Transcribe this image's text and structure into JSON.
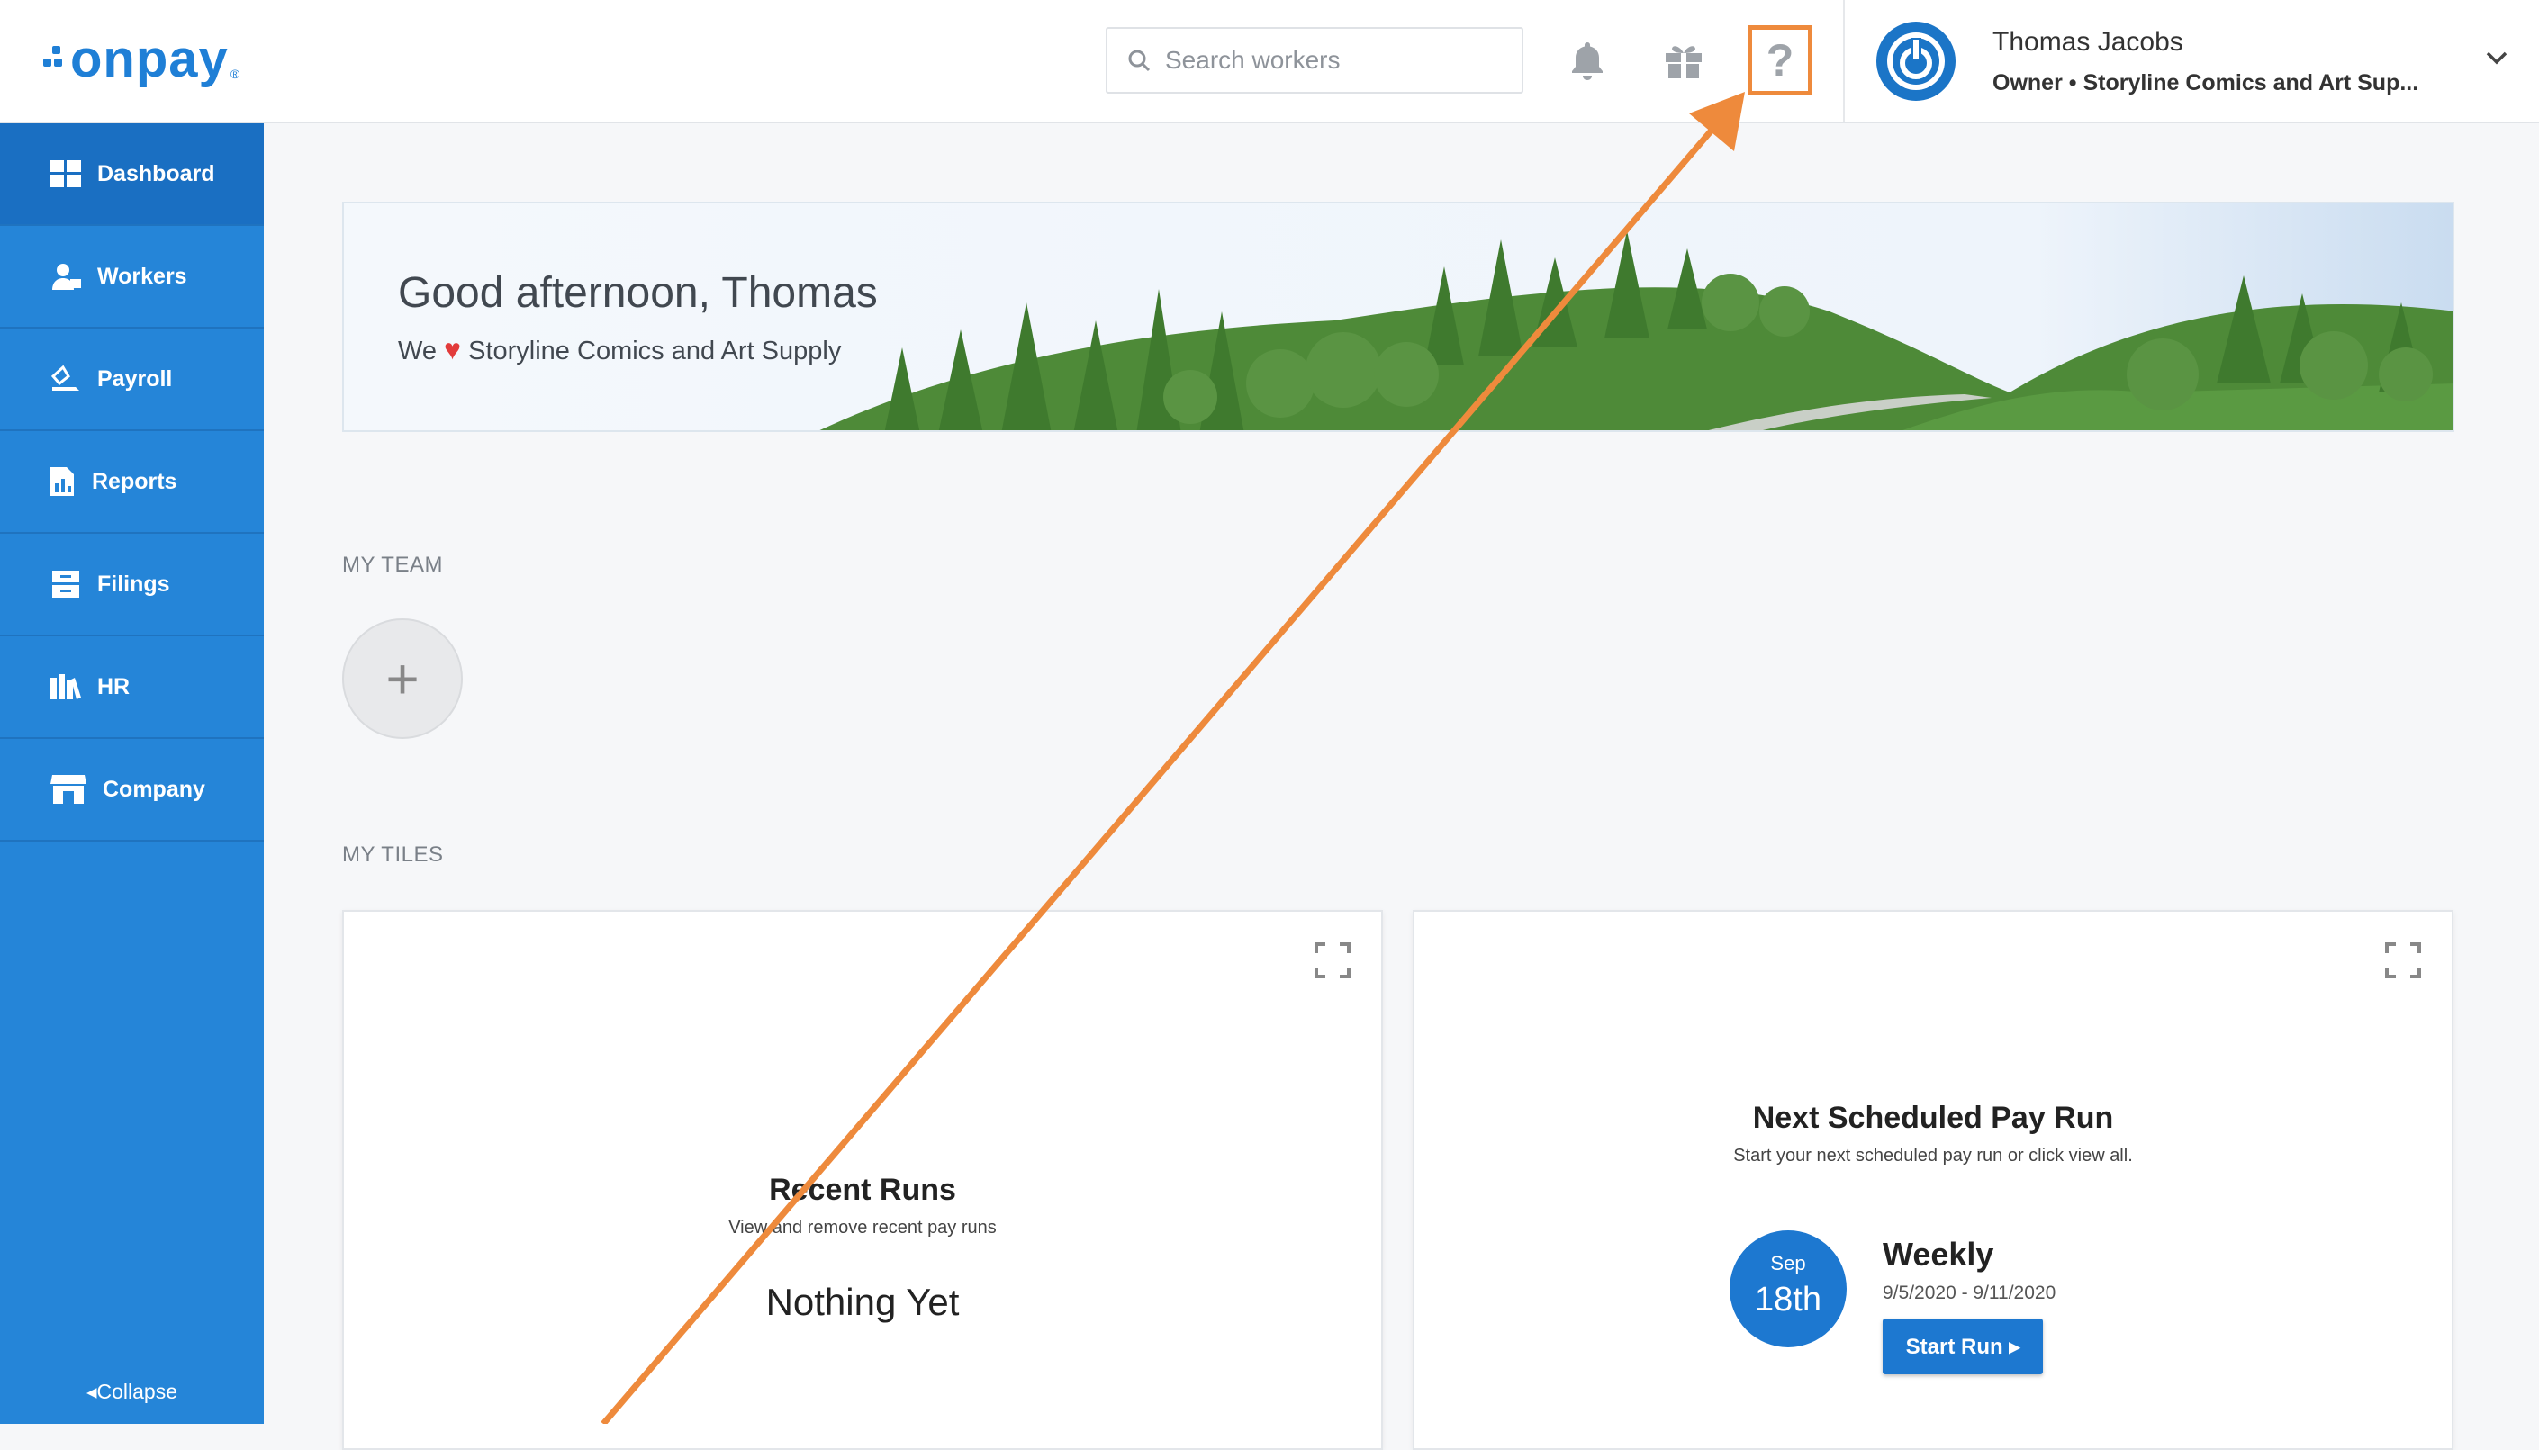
{
  "brand": {
    "logo_text": "onpay",
    "color": "#1f7fd6"
  },
  "search": {
    "placeholder": "Search workers"
  },
  "header_icons": [
    "bell-icon",
    "gift-icon",
    "help-icon"
  ],
  "help": {
    "glyph": "?"
  },
  "user": {
    "name": "Thomas Jacobs",
    "role": "Owner • Storyline Comics and Art Sup..."
  },
  "sidebar": {
    "items": [
      {
        "label": "Dashboard",
        "icon": "dashboard-icon",
        "active": true
      },
      {
        "label": "Workers",
        "icon": "workers-icon"
      },
      {
        "label": "Payroll",
        "icon": "payroll-icon"
      },
      {
        "label": "Reports",
        "icon": "reports-icon"
      },
      {
        "label": "Filings",
        "icon": "filings-icon"
      },
      {
        "label": "HR",
        "icon": "hr-icon"
      },
      {
        "label": "Company",
        "icon": "company-icon"
      }
    ],
    "collapse_label": "Collapse"
  },
  "banner": {
    "greeting": "Good afternoon, Thomas",
    "love_prefix": "We",
    "love_company": "Storyline Comics and Art Supply"
  },
  "my_team": {
    "label": "MY TEAM",
    "add_glyph": "+"
  },
  "my_tiles": {
    "label": "MY TILES",
    "recent_runs": {
      "title": "Recent Runs",
      "subtitle": "View and remove recent pay runs",
      "empty": "Nothing Yet"
    },
    "next_pay_run": {
      "title": "Next Scheduled Pay Run",
      "subtitle": "Start your next scheduled pay run or click view all.",
      "month": "Sep",
      "day": "18th",
      "frequency": "Weekly",
      "range": "9/5/2020 - 9/11/2020",
      "button": "Start Run"
    }
  },
  "colors": {
    "accent": "#2585d8",
    "highlight": "#ee8a3c"
  }
}
